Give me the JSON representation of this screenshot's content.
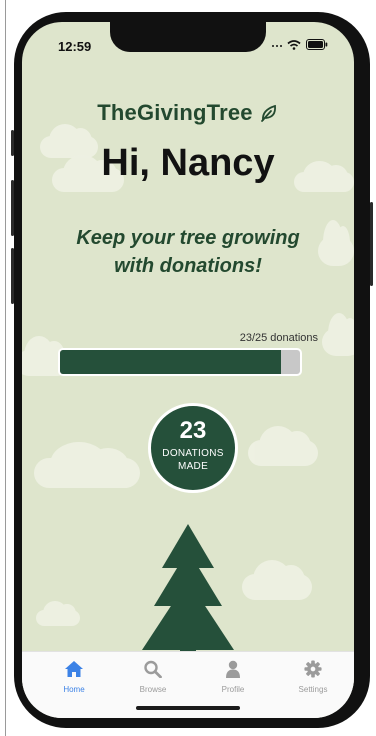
{
  "status_bar": {
    "time": "12:59"
  },
  "header": {
    "brand": "TheGivingTree"
  },
  "main": {
    "greeting": "Hi, Nancy",
    "tagline_line1": "Keep your tree growing",
    "tagline_line2": "with donations!",
    "progress": {
      "label": "23/25 donations",
      "current": 23,
      "goal": 25,
      "fraction": 0.92
    },
    "badge": {
      "count": "23",
      "label_line1": "DONATIONS",
      "label_line2": "MADE"
    }
  },
  "tabbar": {
    "items": [
      {
        "label": "Home",
        "icon": "home-icon",
        "active": true
      },
      {
        "label": "Browse",
        "icon": "search-icon",
        "active": false
      },
      {
        "label": "Profile",
        "icon": "profile-icon",
        "active": false
      },
      {
        "label": "Settings",
        "icon": "gear-icon",
        "active": false
      }
    ]
  },
  "colors": {
    "background": "#dee5cc",
    "brand_green": "#25503a",
    "active_tab": "#3c82e6",
    "inactive_tab": "#9b9b9b"
  }
}
